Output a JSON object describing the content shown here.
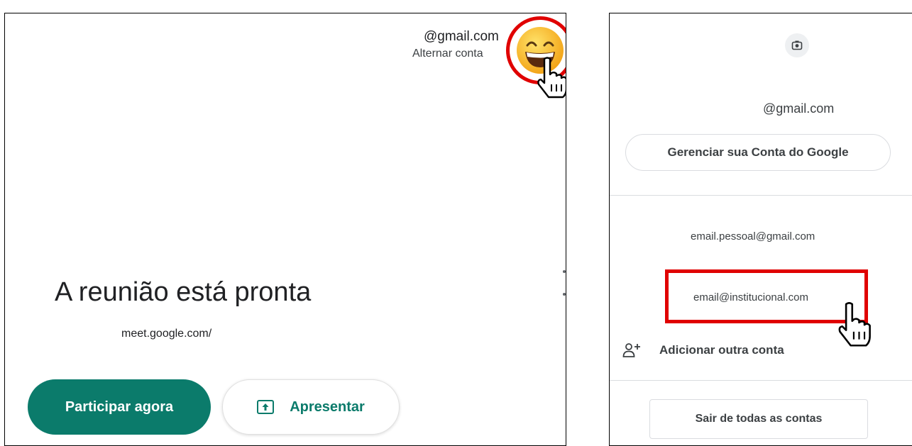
{
  "left_panel": {
    "account": {
      "email": "@gmail.com",
      "switch_label": "Alternar conta"
    },
    "meeting": {
      "title": "A reunião está pronta",
      "url": "meet.google.com/"
    },
    "buttons": {
      "join": "Participar agora",
      "present": "Apresentar"
    }
  },
  "right_panel": {
    "profile_email": "@gmail.com",
    "manage_account": "Gerenciar sua Conta do Google",
    "accounts": [
      "email.pessoal@gmail.com",
      "email@institucional.com"
    ],
    "add_account": "Adicionar outra conta",
    "sign_out_all": "Sair de todas as contas"
  },
  "colors": {
    "accent_green": "#0b7b6b",
    "highlight_red": "#e00000"
  },
  "icons": [
    "grinning-emoji-icon",
    "hand-cursor-icon",
    "present-upload-icon",
    "camera-icon",
    "add-person-icon"
  ]
}
